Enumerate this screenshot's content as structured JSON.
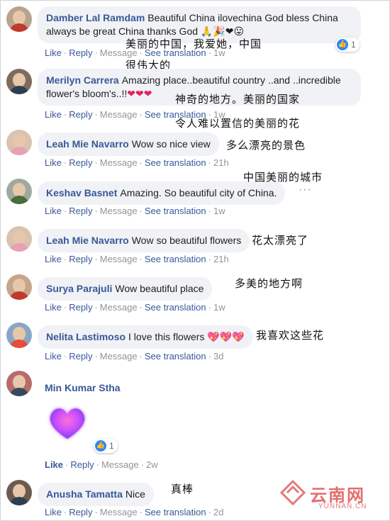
{
  "actions": {
    "like": "Like",
    "reply": "Reply",
    "message": "Message",
    "see_translation": "See translation",
    "separator": "·"
  },
  "comments": [
    {
      "name": "Damber Lal Ramdam",
      "text": "Beautiful China ilovechina God bless China always be great China thanks God",
      "emoji": "🙏🎉❤😛",
      "time": "1w",
      "reaction_count": "1",
      "zh": [
        "美丽的中国，我爱她，中国",
        "很伟大的"
      ]
    },
    {
      "name": "Merilyn Carrera",
      "text": "Amazing place..beautiful country ..and ..incredible flower's bloom's..!!",
      "emoji": "❤❤❤",
      "time": "1w",
      "zh": [
        "神奇的地方。美丽的国家",
        "令人难以置信的美丽的花"
      ]
    },
    {
      "name": "Leah Mie Navarro",
      "text": "Wow so nice view",
      "time": "21h",
      "zh": [
        "多么漂亮的景色"
      ]
    },
    {
      "name": "Keshav Basnet",
      "text": "Amazing. So beautiful city of China.",
      "time": "1w",
      "zh": [
        "中国美丽的城市"
      ]
    },
    {
      "name": "Leah Mie Navarro",
      "text": "Wow so beautiful flowers",
      "time": "21h",
      "zh": [
        "花太漂亮了"
      ]
    },
    {
      "name": "Surya Parajuli",
      "text": "Wow beautiful place",
      "time": "1w",
      "zh": [
        "多美的地方啊"
      ]
    },
    {
      "name": "Nelita Lastimoso",
      "text": "I love this flowers",
      "emoji": "💖💖💖",
      "time": "3d",
      "zh": [
        "我喜欢这些花"
      ]
    },
    {
      "name": "Min Kumar Stha",
      "text": "",
      "time": "2w",
      "reaction_count": "1",
      "sticker": "heart-sticker"
    },
    {
      "name": "Anusha Tamatta",
      "text": "Nice",
      "time": "2d",
      "zh": [
        "真棒"
      ]
    }
  ],
  "watermark": {
    "text": "云南网",
    "sub": "YUNNAN.CN"
  },
  "colors": {
    "link": "#385898",
    "bubble": "#f0f2f5",
    "muted": "#90949c",
    "like_blue": "#2d88ff",
    "heart": "#e0245e"
  }
}
